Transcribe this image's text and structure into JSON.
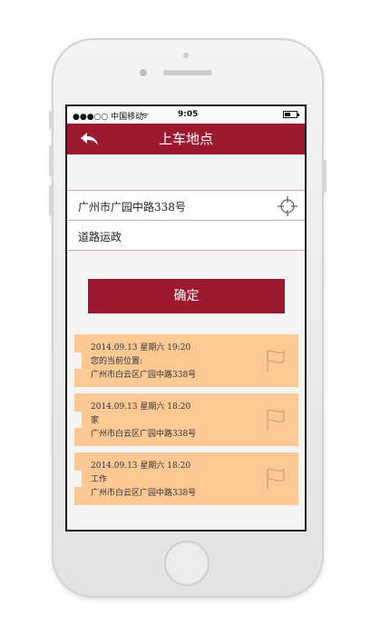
{
  "status": {
    "carrier": "●●●○○ 中国移动",
    "wifi": "ᯤ",
    "time": "9:05"
  },
  "nav": {
    "title": "上车地点",
    "back_icon": "back-arrow-icon"
  },
  "address_field": {
    "value": "广州市广园中路338号",
    "icon": "locate-target-icon"
  },
  "note_field": {
    "value": "道路运政"
  },
  "confirm_button": {
    "label": "确定"
  },
  "history": [
    {
      "date": "2014.09.13  星期六  19:20",
      "name": "您的当前位置:",
      "address": "广州市白云区广园中路338号"
    },
    {
      "date": "2014.09.13  星期六  18:20",
      "name": "家",
      "address": "广州市白云区广园中路338号"
    },
    {
      "date": "2014.09.13  星期六  18:20",
      "name": "工作",
      "address": "广州市白云区广园中路338号"
    }
  ],
  "colors": {
    "brand": "#9b1a2f",
    "card": "#fcc995",
    "field_border": "#e3a5ad"
  }
}
